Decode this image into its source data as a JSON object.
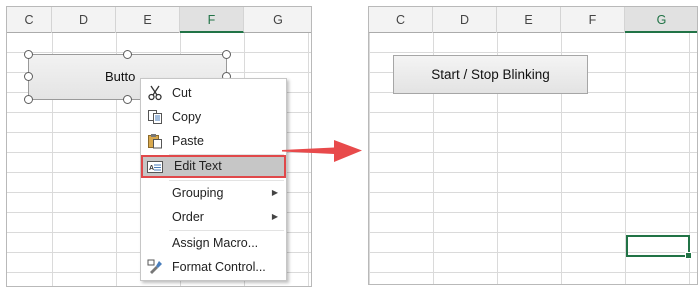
{
  "left_sheet": {
    "columns": [
      "C",
      "D",
      "E",
      "F",
      "G"
    ],
    "active_column": "F",
    "button_text": "Butto"
  },
  "context_menu": {
    "items": [
      {
        "label": "Cut",
        "icon": "scissors-icon"
      },
      {
        "label": "Copy",
        "icon": "copy-icon"
      },
      {
        "label": "Paste",
        "icon": "paste-icon"
      },
      {
        "label": "Edit Text",
        "icon": "edit-text-icon",
        "highlighted": true
      },
      {
        "label": "Grouping",
        "submenu": true
      },
      {
        "label": "Order",
        "submenu": true
      },
      {
        "label": "Assign Macro..."
      },
      {
        "label": "Format Control...",
        "icon": "format-control-icon"
      }
    ]
  },
  "right_sheet": {
    "columns": [
      "C",
      "D",
      "E",
      "F",
      "G"
    ],
    "active_column": "G",
    "button_label": "Start / Stop Blinking"
  },
  "colors": {
    "highlight_border": "#e0484a",
    "arrow": "#e84a4b",
    "selection": "#217346"
  }
}
